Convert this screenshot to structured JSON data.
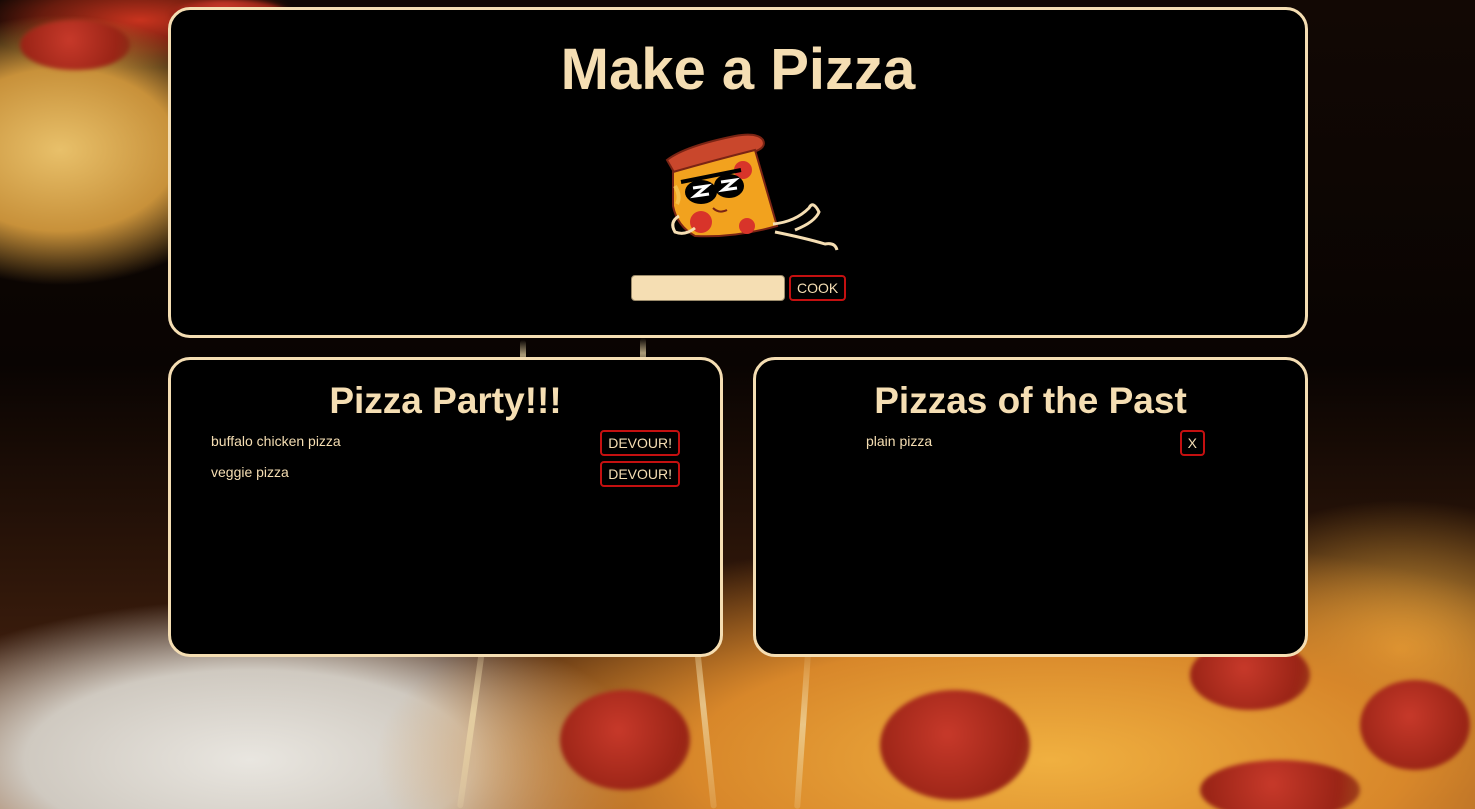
{
  "header": {
    "title": "Make a Pizza",
    "input_value": "",
    "input_placeholder": "",
    "cook_label": "COOK"
  },
  "party": {
    "title": "Pizza Party!!!",
    "items": [
      {
        "name": "buffalo chicken pizza",
        "action_label": "DEVOUR!"
      },
      {
        "name": "veggie pizza",
        "action_label": "DEVOUR!"
      }
    ]
  },
  "past": {
    "title": "Pizzas of the Past",
    "items": [
      {
        "name": "plain pizza",
        "action_label": "X"
      }
    ]
  },
  "colors": {
    "accent": "#f5deb3",
    "button_border": "#c41010",
    "panel_bg": "#000000"
  },
  "icons": {
    "mascot": "cool-pizza-slice-icon"
  }
}
